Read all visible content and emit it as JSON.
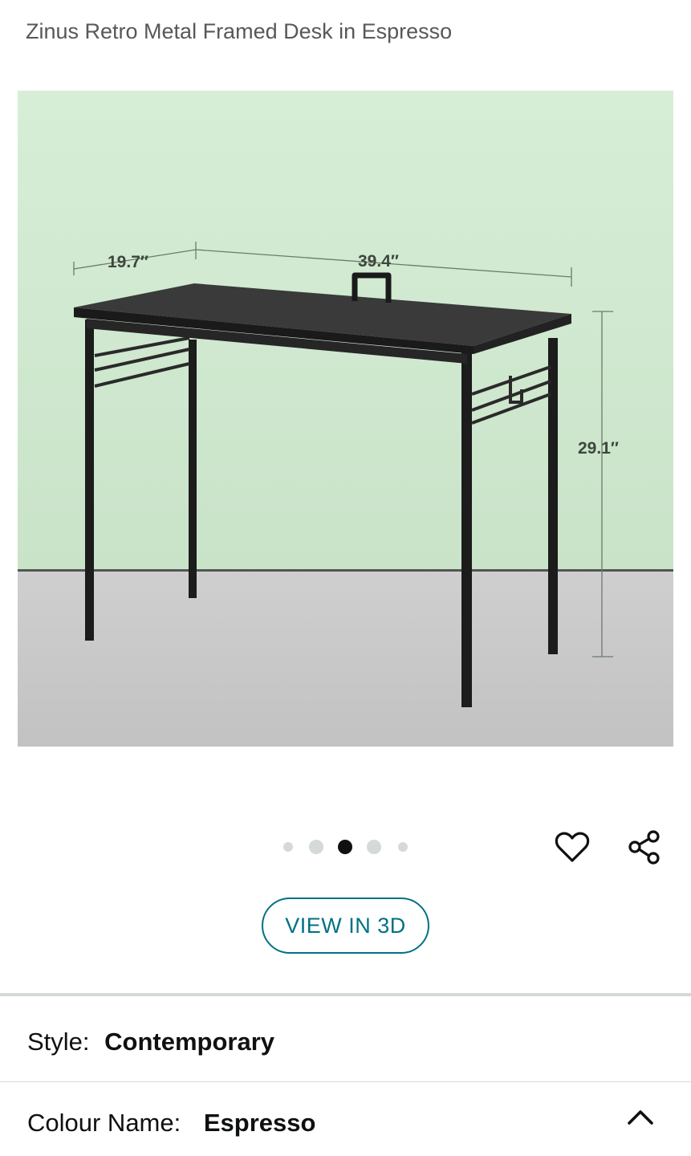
{
  "product": {
    "title": "Zinus Retro Metal Framed Desk in Espresso"
  },
  "image": {
    "dimensions": {
      "depth": "19.7″",
      "width": "39.4″",
      "height": "29.1″"
    },
    "carousel": {
      "count": 5,
      "active_index": 2
    }
  },
  "actions": {
    "favorite_icon": "heart-outline-icon",
    "share_icon": "share-icon",
    "view_3d_label": "VIEW IN 3D"
  },
  "variations": {
    "style_label": "Style:",
    "style_value": "Contemporary",
    "colour_label": "Colour Name:",
    "colour_value": "Espresso",
    "expand_icon": "chevron-up-icon"
  },
  "colors": {
    "link": "#007185",
    "text": "#0f1111",
    "muted": "#565959",
    "divider": "#d5d9d9"
  }
}
